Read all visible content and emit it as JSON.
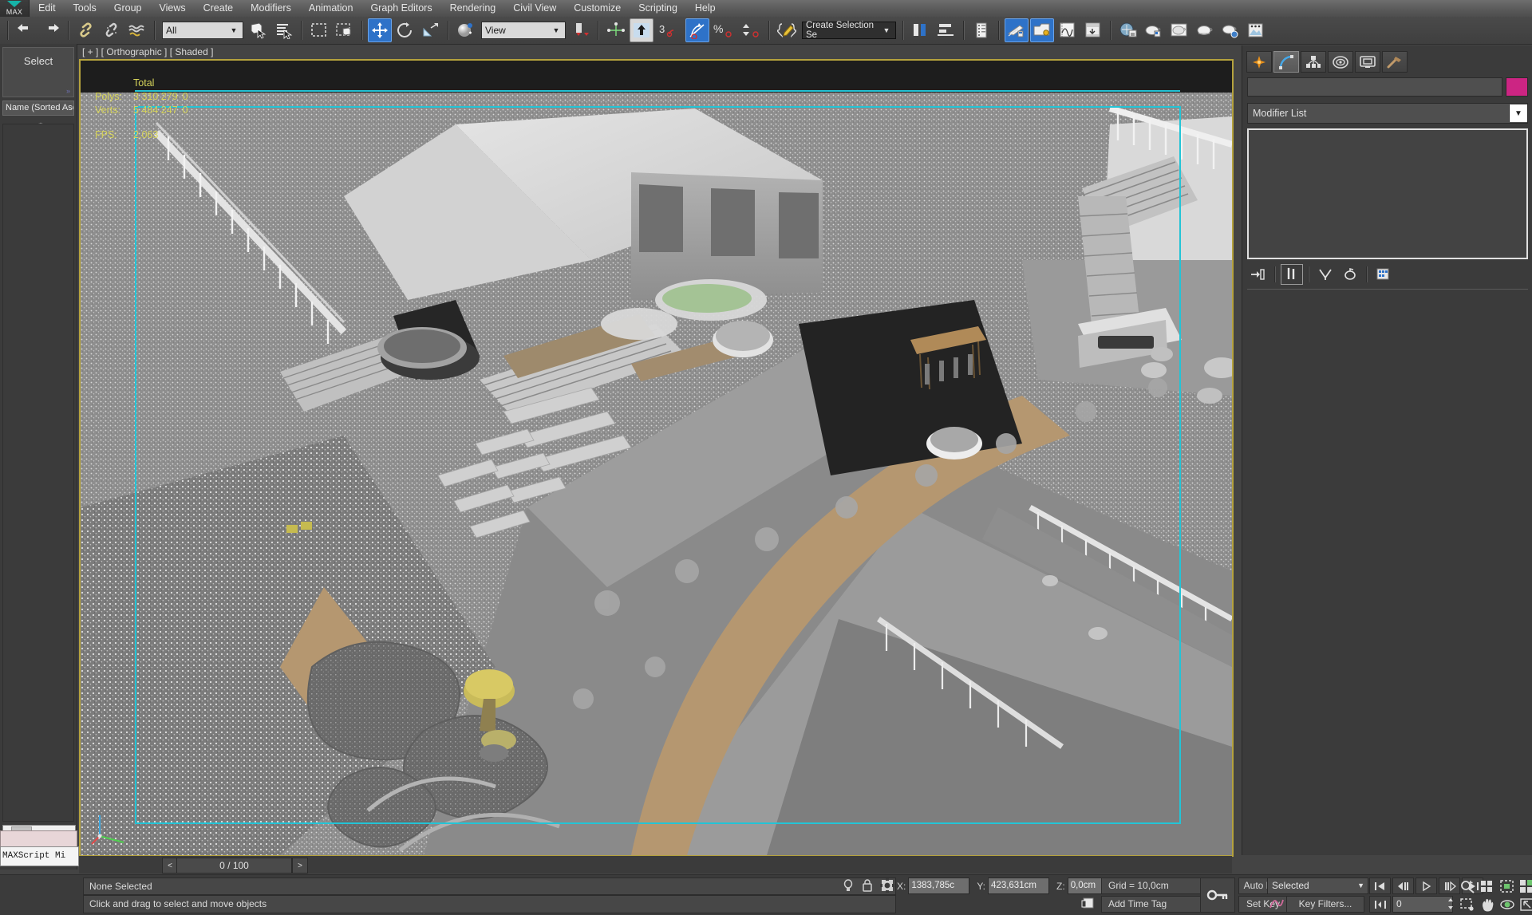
{
  "app": {
    "logo_label": "MAX"
  },
  "menu": {
    "items": [
      {
        "label": "Edit"
      },
      {
        "label": "Tools"
      },
      {
        "label": "Group"
      },
      {
        "label": "Views"
      },
      {
        "label": "Create"
      },
      {
        "label": "Modifiers"
      },
      {
        "label": "Animation"
      },
      {
        "label": "Graph Editors"
      },
      {
        "label": "Rendering"
      },
      {
        "label": "Civil View"
      },
      {
        "label": "Customize"
      },
      {
        "label": "Scripting"
      },
      {
        "label": "Help"
      }
    ]
  },
  "toolbar": {
    "undo_name": "undo-button",
    "redo_name": "redo-button",
    "selection_filter": "All",
    "reference_coordinate_system": "View",
    "named_selection_set": "Create Selection Se",
    "angle_snap_value": "3",
    "percent_snap_label": "%"
  },
  "left_panel": {
    "title": "Select",
    "sort_label": "Name (Sorted Asc",
    "maxscript_label": "MAXScript Mi"
  },
  "viewport": {
    "label": "[ + ] [ Orthographic ] [ Shaded ]",
    "stats": {
      "total_header": "Total",
      "rows": [
        {
          "label": "Polys:",
          "value": "3 310 279",
          "second": "0"
        },
        {
          "label": "Verts:",
          "value": "5 484 247",
          "second": "0"
        }
      ],
      "fps_label": "FPS:",
      "fps_value": "2,063"
    },
    "border_color": "#b5a23d",
    "gizmo_color": "#23c4d6"
  },
  "command_panel": {
    "tabs": [
      {
        "name": "create-tab",
        "label": "Create"
      },
      {
        "name": "modify-tab",
        "label": "Modify"
      },
      {
        "name": "hierarchy-tab",
        "label": "Hierarchy"
      },
      {
        "name": "motion-tab",
        "label": "Motion"
      },
      {
        "name": "display-tab",
        "label": "Display"
      },
      {
        "name": "utilities-tab",
        "label": "Utilities"
      }
    ],
    "active_tab_index": 1,
    "object_name": "",
    "object_color": "#cc2583",
    "modifier_list_label": "Modifier List"
  },
  "time_slider": {
    "prev_label": "<",
    "next_label": ">",
    "frame_label": "0 / 100"
  },
  "status_bar": {
    "selection_status": "None Selected",
    "prompt": "Click and drag to select and move objects",
    "coords": [
      {
        "axis": "X:",
        "value": "1383,785c"
      },
      {
        "axis": "Y:",
        "value": "423,631cm"
      },
      {
        "axis": "Z:",
        "value": "0,0cm"
      }
    ],
    "grid_label": "Grid = 10,0cm",
    "add_time_tag": "Add Time Tag",
    "auto_key": "Auto Key",
    "set_key": "Set Key",
    "key_mode": "Selected",
    "key_filters": "Key Filters...",
    "spinner_value": "0"
  }
}
